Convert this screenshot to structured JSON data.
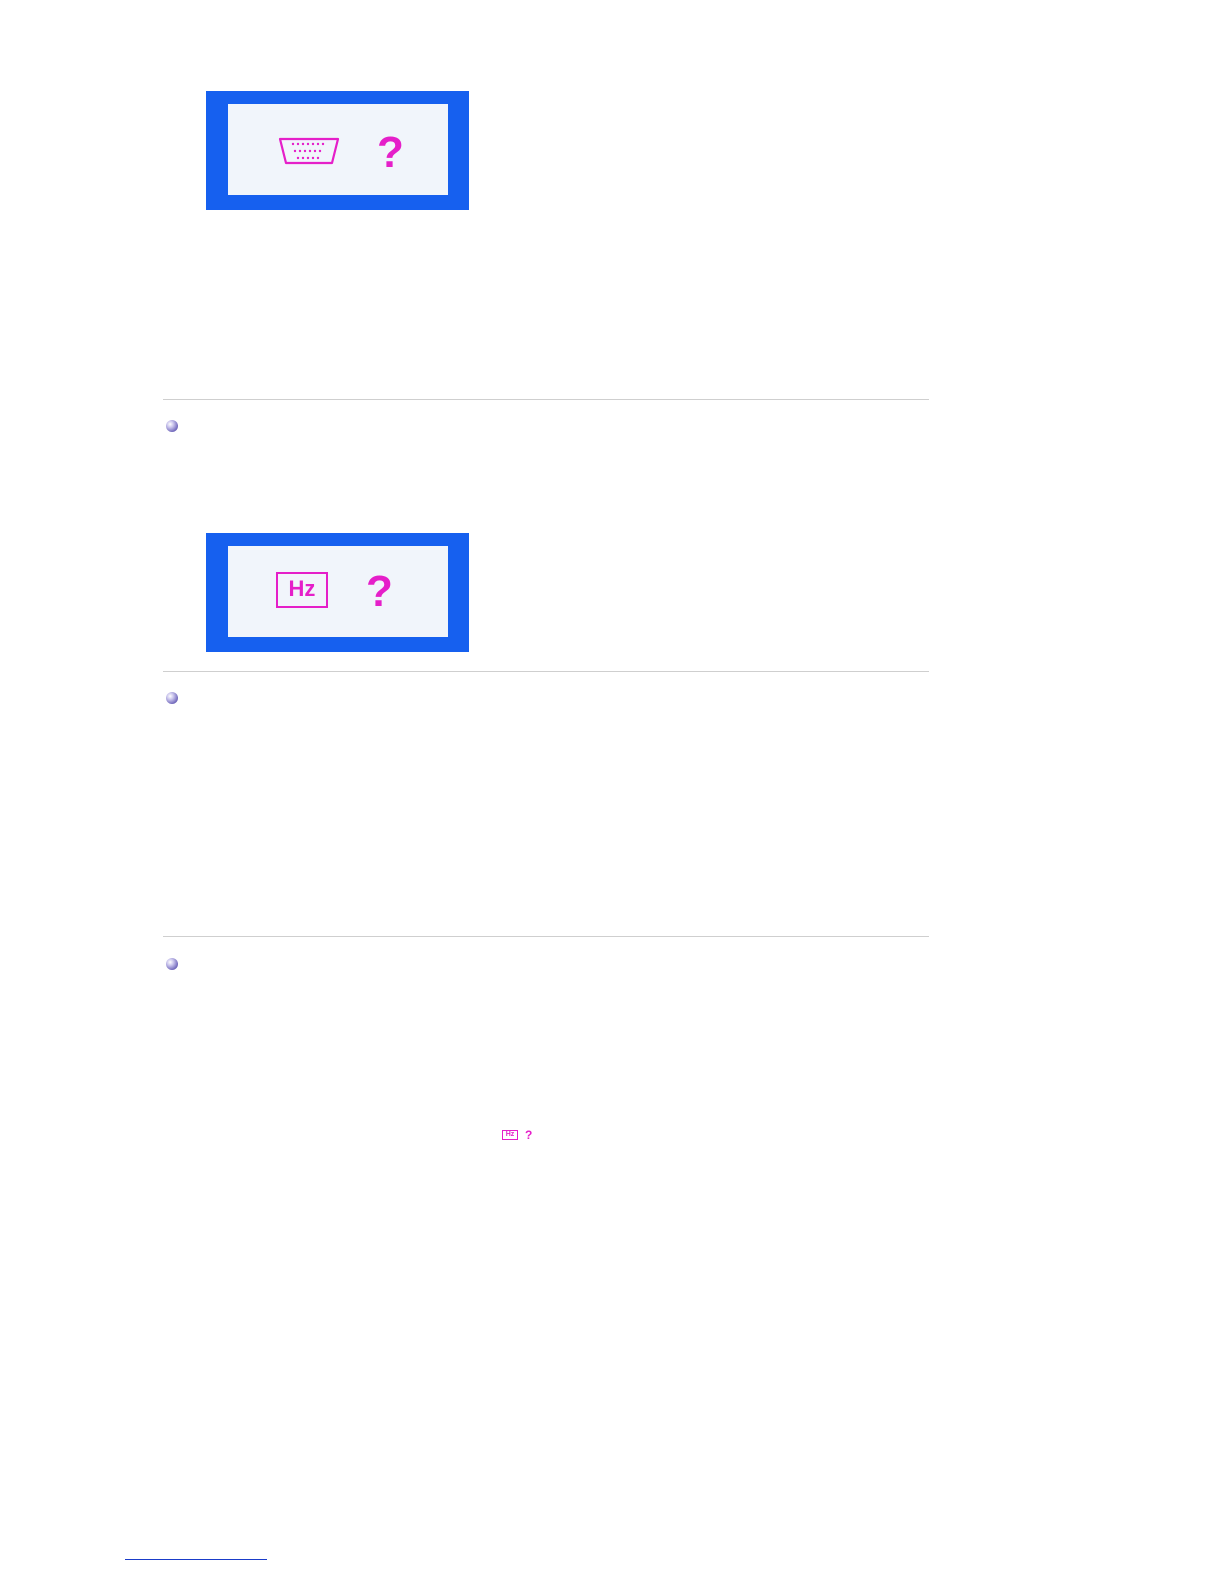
{
  "colors": {
    "osd_frame": "#1660ef",
    "osd_background": "#f1f5fb",
    "osd_symbol": "#e51fc9",
    "divider": "#cfcfcf",
    "link_underline": "#1a3cc9"
  },
  "osd_screens": [
    {
      "icon": "signal-connector-icon",
      "symbol": "?"
    },
    {
      "icon": "hz-frequency-icon",
      "icon_text": "Hz",
      "symbol": "?"
    }
  ],
  "inline_message": {
    "icon": "hz-frequency-icon",
    "icon_text": "Hz",
    "symbol": "?"
  },
  "bullets": [
    {
      "icon": "bullet-sphere-icon"
    },
    {
      "icon": "bullet-sphere-icon"
    },
    {
      "icon": "bullet-sphere-icon"
    }
  ]
}
